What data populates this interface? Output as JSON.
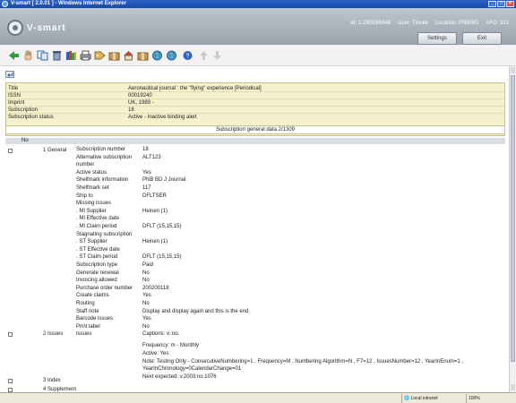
{
  "window": {
    "title": "V-smart [ 2.0.01 ] - Windows Internet Explorer",
    "buttons": [
      "_",
      "□",
      "×"
    ]
  },
  "header": {
    "logo_text": "V-smart",
    "id_text": "Id: 1.23003/6848",
    "user_text": "User: Tineke",
    "location_text": "Location: PNB/BD",
    "afo_text": "AFO: 321",
    "settings_label": "Settings",
    "exit_label": "Exit"
  },
  "toolbar": {
    "icons": [
      "arrow-left-icon",
      "hand-icon",
      "copy-icon",
      "trash-icon",
      "books-icon",
      "printer-icon",
      "tag-icon",
      "package-icon",
      "home-icon",
      "package-icon",
      "globe-icon",
      "globe-icon",
      "help-icon",
      "arrow-up-icon",
      "arrow-down-icon"
    ]
  },
  "info": {
    "rows": [
      {
        "label": "Title",
        "value": "Aeronautical journal : the \"flying\" experience [Periodical]"
      },
      {
        "label": "ISSN",
        "value": "00019240"
      },
      {
        "label": "Imprint",
        "value": "UK, 1989 -"
      },
      {
        "label": "Subscription",
        "value": "18"
      },
      {
        "label": "Subscription status",
        "value": "Active - Inactive binding alert"
      }
    ]
  },
  "section": {
    "title": "Subscription general data 2/1309",
    "col_no": "No"
  },
  "general": {
    "row_label": "1 General",
    "fields": [
      {
        "label": "Subscription number",
        "value": "18"
      },
      {
        "label": "Alternative subscription",
        "value": "ALT123"
      },
      {
        "label": "number",
        "value": ""
      },
      {
        "label": "Active status",
        "value": "Yes"
      },
      {
        "label": "Shelfmark information",
        "value": "PNB BD J Journal"
      },
      {
        "label": "Shelfmark set",
        "value": "117"
      },
      {
        "label": "Ship to",
        "value": "DFLTSER"
      },
      {
        "label": "Missing issues",
        "value": ""
      },
      {
        "label": ". MI Supplier",
        "value": "Heinen (1)"
      },
      {
        "label": ". MI Effective date",
        "value": ""
      },
      {
        "label": ". MI Claim period",
        "value": "DFLT (15,15,15)"
      },
      {
        "label": "Stagnating subscription",
        "value": ""
      },
      {
        "label": ". ST Supplier",
        "value": "Heinen (1)"
      },
      {
        "label": ". ST Effective date",
        "value": ""
      },
      {
        "label": ". ST Claim period",
        "value": "DFLT (15,15,15)"
      },
      {
        "label": "Subscription type",
        "value": "Paid"
      },
      {
        "label": "Generate renewal",
        "value": "No"
      },
      {
        "label": "Invoicing allowed",
        "value": "No"
      },
      {
        "label": "Purchase order number",
        "value": "200200118"
      },
      {
        "label": "Create claims",
        "value": "Yes"
      },
      {
        "label": "Routing",
        "value": "No"
      },
      {
        "label": "Staff note",
        "value": "Display and display again and this is the end"
      },
      {
        "label": "Barcode issues",
        "value": "Yes"
      },
      {
        "label": "Print label",
        "value": "No"
      }
    ]
  },
  "issues": {
    "row_label": "2 Issues",
    "field_label": "Issues",
    "lines": [
      "Captions: v.:no.",
      "",
      "Frequency: m - Monthly",
      "Active: Yes",
      "Note: Testing Only - ConsecutiveNumbering=1 , Frequency=M , Numbering Algorithm=N , F7=12 , IssuesNumber=12 , YearInEnum=1 ,",
      "YearInChronology=0CalendarChange=01",
      "Next expected: v.2003:no.1076"
    ]
  },
  "index": {
    "row_label": "3 Index"
  },
  "supplement": {
    "row_label": "4 Supplement"
  },
  "statusbar": {
    "zone": "Local intranet",
    "zoom": "100%"
  },
  "colors": {
    "title_bar": "#2f63c8",
    "header": "#aab2bb",
    "info_panel": "#f5f1cc"
  }
}
